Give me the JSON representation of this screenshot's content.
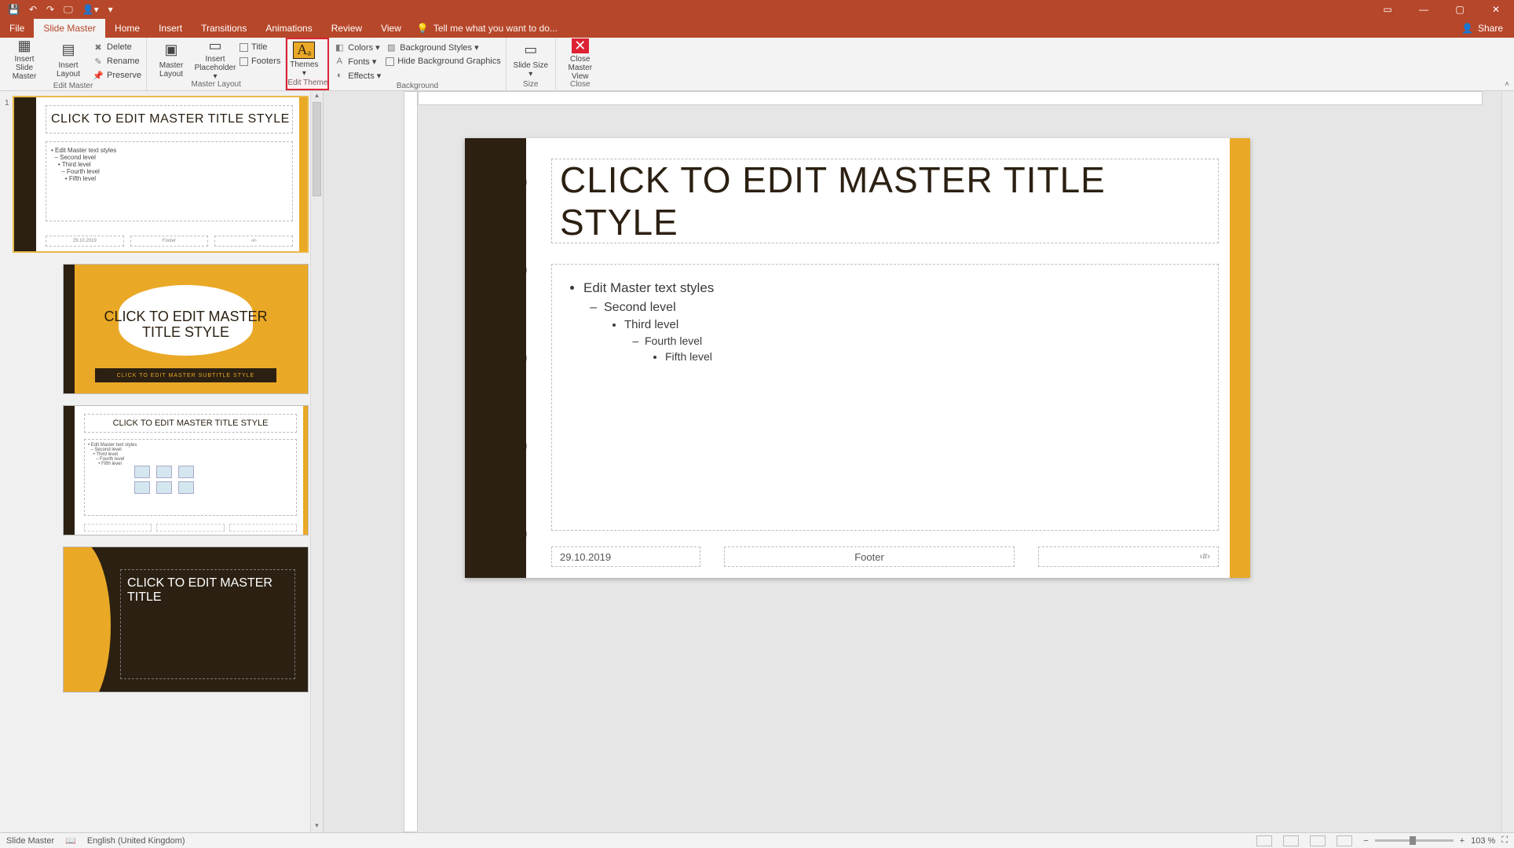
{
  "qat": {
    "save": "💾",
    "undo": "↶",
    "redo": "↷",
    "start": "🖵",
    "touch": "👤▾",
    "more": "▾"
  },
  "window": {
    "popout": "▭",
    "min": "—",
    "max": "▢",
    "close": "✕"
  },
  "tabs": {
    "file": "File",
    "slide_master": "Slide Master",
    "home": "Home",
    "insert": "Insert",
    "transitions": "Transitions",
    "animations": "Animations",
    "review": "Review",
    "view": "View",
    "tellme_icon": "💡",
    "tellme": "Tell me what you want to do...",
    "share_icon": "👤",
    "share": "Share"
  },
  "ribbon": {
    "edit_master": {
      "insert_slide_master": "Insert Slide Master",
      "insert_layout": "Insert Layout",
      "delete": "Delete",
      "rename": "Rename",
      "preserve": "Preserve",
      "label": "Edit Master"
    },
    "master_layout": {
      "master_layout": "Master Layout",
      "insert_placeholder": "Insert Placeholder ▾",
      "title": "Title",
      "footers": "Footers",
      "label": "Master Layout"
    },
    "edit_theme": {
      "themes": "Themes ▾",
      "label": "Edit Theme"
    },
    "background": {
      "colors": "Colors ▾",
      "fonts": "Fonts ▾",
      "effects": "Effects ▾",
      "bg_styles": "Background Styles ▾",
      "hide_bg": "Hide Background Graphics",
      "label": "Background"
    },
    "size": {
      "slide_size": "Slide Size ▾",
      "label": "Size"
    },
    "close": {
      "close_master": "Close Master View",
      "label": "Close"
    }
  },
  "thumbs": {
    "master_index": "1",
    "master_title": "CLICK TO EDIT MASTER TITLE STYLE",
    "master_levels": [
      "Edit Master text styles",
      "Second level",
      "Third level",
      "Fourth level",
      "Fifth level"
    ],
    "master_footer_date": "29.10.2019",
    "master_footer_mid": "Footer",
    "master_footer_num": "‹#›",
    "layout1_title": "CLICK TO EDIT MASTER TITLE STYLE",
    "layout1_sub": "CLICK TO EDIT MASTER SUBTITLE STYLE",
    "layout2_title": "CLICK TO EDIT MASTER TITLE STYLE",
    "layout2_levels": [
      "Edit Master text styles",
      "Second level",
      "Third level",
      "Fourth level",
      "Fifth level"
    ],
    "layout3_title": "CLICK TO EDIT MASTER TITLE"
  },
  "slide": {
    "title": "CLICK TO EDIT MASTER TITLE STYLE",
    "levels": {
      "l1": "Edit Master text styles",
      "l2": "Second level",
      "l3": "Third level",
      "l4": "Fourth level",
      "l5": "Fifth level"
    },
    "footer_date": "29.10.2019",
    "footer_mid": "Footer",
    "footer_num": "‹#›"
  },
  "status": {
    "mode": "Slide Master",
    "lang": "English (United Kingdom)",
    "zoom_minus": "−",
    "zoom_plus": "+",
    "zoom_pct": "103 %",
    "fit": "⛶"
  },
  "collapse": "˄"
}
